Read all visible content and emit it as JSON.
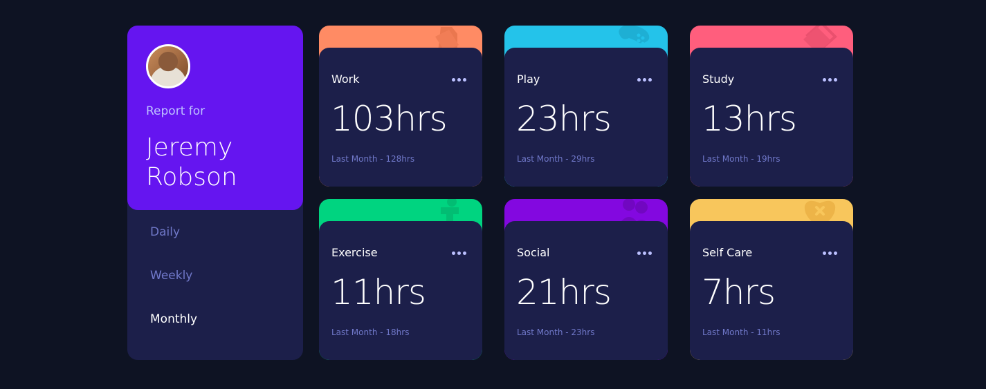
{
  "profile": {
    "report_for": "Report for",
    "name": "Jeremy Robson",
    "periods": [
      {
        "label": "Daily",
        "active": false
      },
      {
        "label": "Weekly",
        "active": false
      },
      {
        "label": "Monthly",
        "active": true
      }
    ]
  },
  "activities": [
    {
      "title": "Work",
      "hours": "103hrs",
      "previous": "Last Month - 128hrs",
      "color": "#ff8b64",
      "icon": "briefcase-icon"
    },
    {
      "title": "Play",
      "hours": "23hrs",
      "previous": "Last Month - 29hrs",
      "color": "#24c3ea",
      "icon": "gamepad-icon"
    },
    {
      "title": "Study",
      "hours": "13hrs",
      "previous": "Last Month - 19hrs",
      "color": "#ff5e7d",
      "icon": "book-icon"
    },
    {
      "title": "Exercise",
      "hours": "11hrs",
      "previous": "Last Month - 18hrs",
      "color": "#00d480",
      "icon": "runner-icon"
    },
    {
      "title": "Social",
      "hours": "21hrs",
      "previous": "Last Month - 23hrs",
      "color": "#8308e0",
      "icon": "people-icon"
    },
    {
      "title": "Self Care",
      "hours": "7hrs",
      "previous": "Last Month - 11hrs",
      "color": "#f8c65c",
      "icon": "heart-icon"
    }
  ],
  "colors": {
    "background": "#0e1323",
    "card": "#1c1f4a",
    "profile_accent": "#6515f0",
    "muted_text": "#7078c9"
  }
}
